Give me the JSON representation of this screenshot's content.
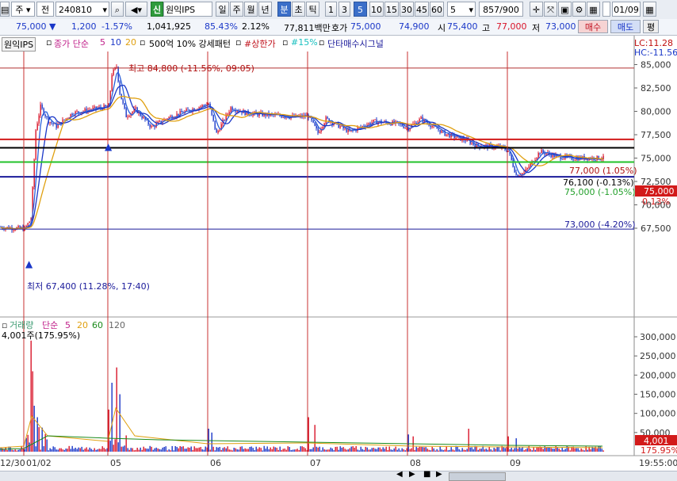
{
  "toolbar": {
    "market": "주",
    "mode": "전",
    "code": "240810",
    "new_badge": "신",
    "stock_name": "원익IPS",
    "periods": [
      "일",
      "주",
      "월",
      "년",
      "분",
      "초",
      "틱"
    ],
    "selected_period": "분",
    "intervals": [
      "1",
      "3",
      "5",
      "10",
      "15",
      "30",
      "45",
      "60"
    ],
    "selected_interval": "5",
    "interval_value": "5",
    "count": "857",
    "count_total": "/900",
    "date": "01/09"
  },
  "quote": {
    "price": "75,000",
    "change": "1,200",
    "change_pct": "-1.57%",
    "volume": "1,041,925",
    "ratio": "85.43%",
    "turnover": "2.12%",
    "amount": "77,811백만",
    "bid_label": "호가",
    "bid": "75,000",
    "ask": "74,900",
    "open_label": "시",
    "open": "75,400",
    "high_label": "고",
    "high": "77,000",
    "low_label": "저",
    "low": "73,000",
    "buy_button": "매수",
    "sell_button": "매도",
    "eval_button": "평"
  },
  "legend": {
    "name": "원익IPS",
    "close_label": "종가 단순",
    "ma1": "5",
    "ma2": "10",
    "ma3": "20",
    "pattern": "500억 10% 강세패턴",
    "upper_limit": "#상한가",
    "pct15": "#15%",
    "signal": "단타매수시그널"
  },
  "price_chart": {
    "lc_label": "LC:11.28",
    "hc_label": "HC:-11.56",
    "high_annotation": "최고 84,800 (-11.56%, 09:05)",
    "low_annotation": "최저 67,400 (11.28%, 17:40)",
    "line_77000": "77,000 (1.05%)",
    "line_76100": "76,100 (-0.13%)",
    "line_75000": "75,000 (-1.05%)",
    "line_73000": "73,000 (-4.20%)",
    "current_price_tag": "75,000",
    "current_pct_tag": "0.13%",
    "y_ticks": [
      "85,000",
      "82,500",
      "80,000",
      "77,500",
      "75,000",
      "72,500",
      "70,000",
      "67,500"
    ]
  },
  "volume_chart": {
    "title": "거래량",
    "ma_label": "단순",
    "ma1": "5",
    "ma2": "20",
    "ma3": "60",
    "ma4": "120",
    "value_annotation": "4,001주(175.95%)",
    "y_ticks": [
      "300,000",
      "250,000",
      "200,000",
      "150,000",
      "100,000",
      "50,000"
    ],
    "current_tag": "4,001",
    "current_pct_tag": "175.95%"
  },
  "x_axis": {
    "labels": [
      "12/30",
      "01/02",
      "05",
      "06",
      "07",
      "08",
      "09"
    ],
    "time": "19:55:00"
  },
  "colors": {
    "up": "#d8142a",
    "down": "#1a37c8",
    "ma5": "#2b5fd9",
    "ma10": "#1a37c8",
    "ma20": "#e0a010",
    "line_red": "#d21a1a",
    "line_black": "#000000",
    "line_green": "#22c22a",
    "line_blue": "#1a1a9a"
  },
  "chart_data": {
    "type": "line",
    "title": "원익IPS",
    "series": [
      {
        "name": "종가",
        "x": [
          "12/30",
          "01/02",
          "01/02",
          "01/02",
          "01/05",
          "01/05",
          "01/05",
          "01/06",
          "01/06",
          "01/07",
          "01/07",
          "01/08",
          "01/08",
          "01/09",
          "01/09",
          "01/09"
        ],
        "values": [
          67600,
          67400,
          80500,
          78500,
          80500,
          84800,
          79000,
          80800,
          79600,
          79500,
          77800,
          78900,
          77300,
          76000,
          73500,
          75000
        ]
      }
    ],
    "horizontal_lines": [
      77000,
      76100,
      75000,
      73000,
      67400
    ],
    "ylim": [
      66500,
      86000
    ]
  }
}
